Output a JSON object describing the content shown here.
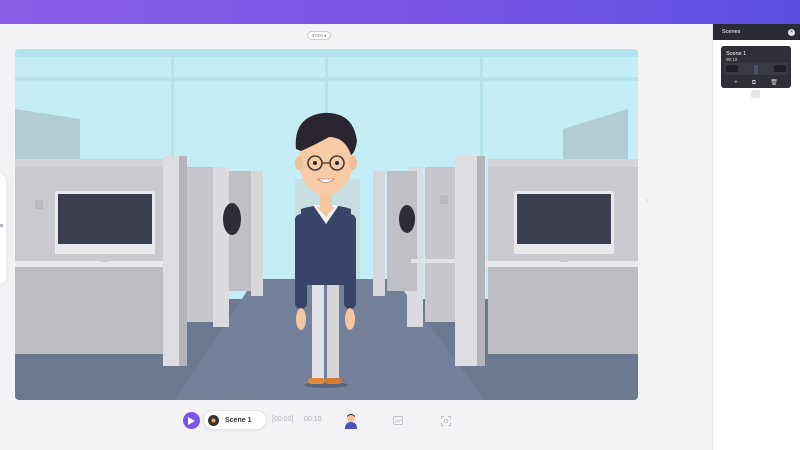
{
  "toolbar": {
    "zoom_label": "374%"
  },
  "player": {
    "scene_label": "Scene 1",
    "time_current": "[00:00]",
    "time_total": "00:10"
  },
  "scenes_panel": {
    "title": "Scenes",
    "cards": [
      {
        "title": "Scene 1",
        "duration": "00:10"
      }
    ]
  },
  "icons": {
    "play": "play-icon",
    "character": "character-icon",
    "background": "background-icon",
    "fit": "fit-screen-icon",
    "close": "close-icon",
    "add": "plus-icon",
    "duplicate": "duplicate-icon",
    "delete": "trash-icon"
  },
  "colors": {
    "accent": "#7b56e6",
    "topbar_start": "#8a5ce6",
    "topbar_end": "#5b4fe0",
    "panel_header": "#2b2b33",
    "sky": "#c3edf6",
    "floor": "#6c7790"
  }
}
